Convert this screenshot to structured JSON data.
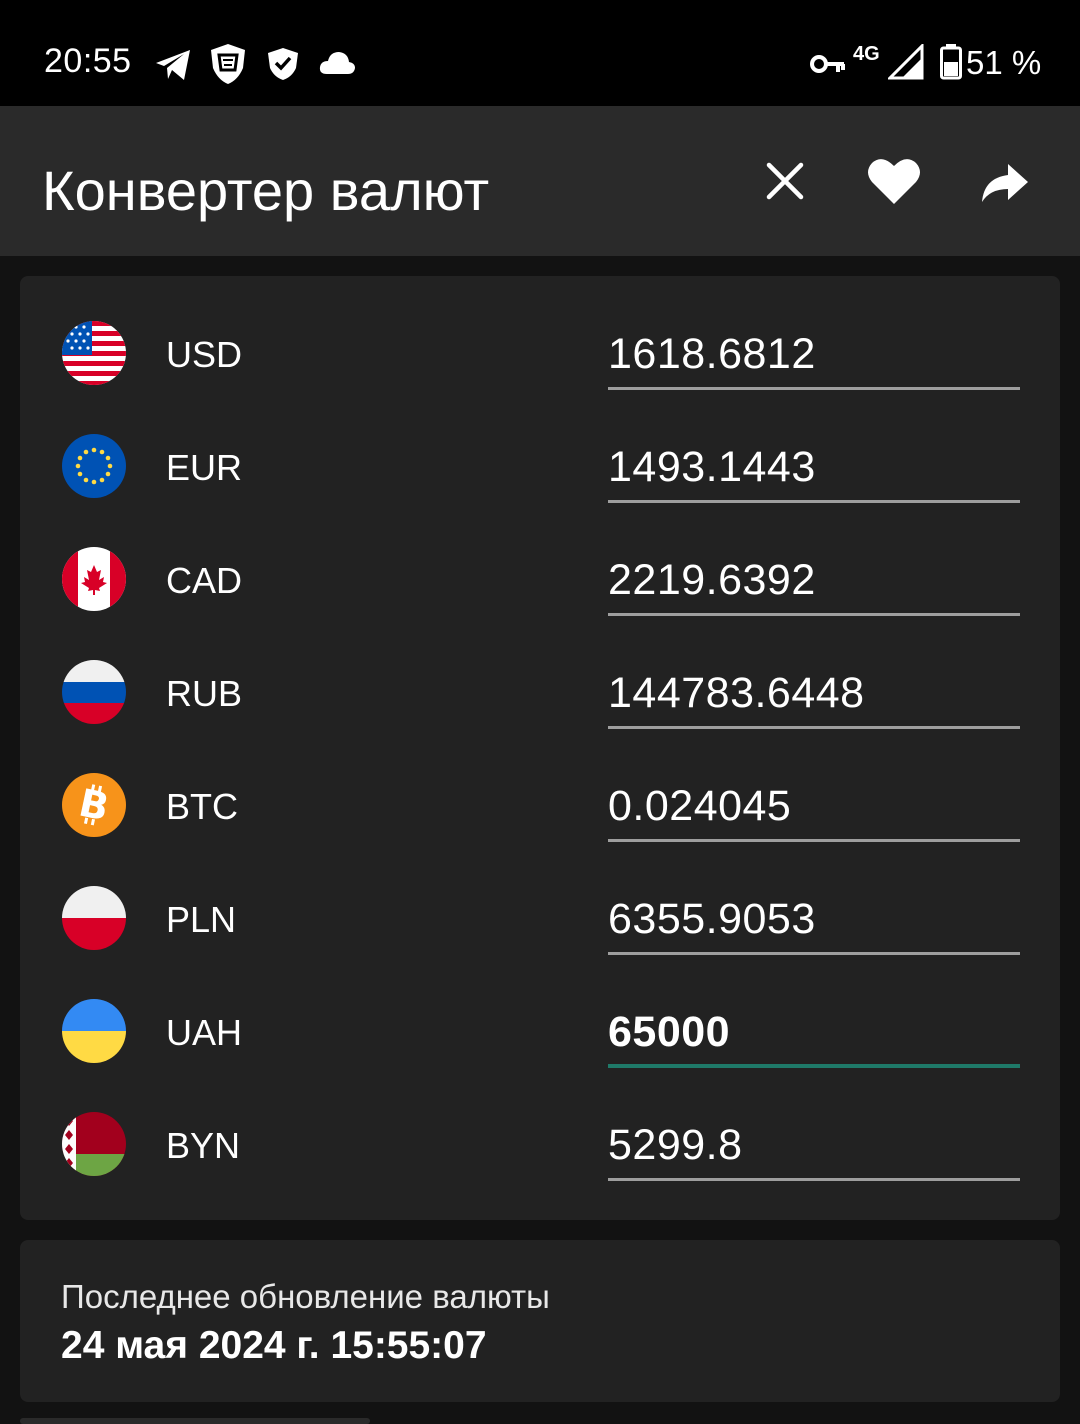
{
  "status_bar": {
    "time": "20:55",
    "network": "4G",
    "battery": "51 %",
    "icons": [
      "telegram-icon",
      "vpn-shield-icon",
      "shield-check-icon",
      "cloud-icon",
      "key-icon",
      "signal-icon",
      "battery-icon"
    ]
  },
  "app_bar": {
    "title": "Конвертер валют",
    "actions": [
      "close-icon",
      "heart-icon",
      "share-icon"
    ]
  },
  "currencies": [
    {
      "code": "USD",
      "value": "1618.6812",
      "flag": "us-flag-icon"
    },
    {
      "code": "EUR",
      "value": "1493.1443",
      "flag": "eu-flag-icon"
    },
    {
      "code": "CAD",
      "value": "2219.6392",
      "flag": "ca-flag-icon"
    },
    {
      "code": "RUB",
      "value": "144783.6448",
      "flag": "ru-flag-icon"
    },
    {
      "code": "BTC",
      "value": "0.024045",
      "flag": "bitcoin-icon"
    },
    {
      "code": "PLN",
      "value": "6355.9053",
      "flag": "pl-flag-icon"
    },
    {
      "code": "UAH",
      "value": "65000",
      "flag": "ua-flag-icon",
      "active": true
    },
    {
      "code": "BYN",
      "value": "5299.8",
      "flag": "by-flag-icon"
    }
  ],
  "update_info": {
    "label": "Последнее обновление валюты",
    "datetime": "24 мая 2024 г. 15:55:07"
  },
  "colors": {
    "background": "#121212",
    "app_bar": "#2a2a2a",
    "card": "#222222",
    "active_underline": "#1f7a69",
    "underline": "#9e9e9e"
  }
}
